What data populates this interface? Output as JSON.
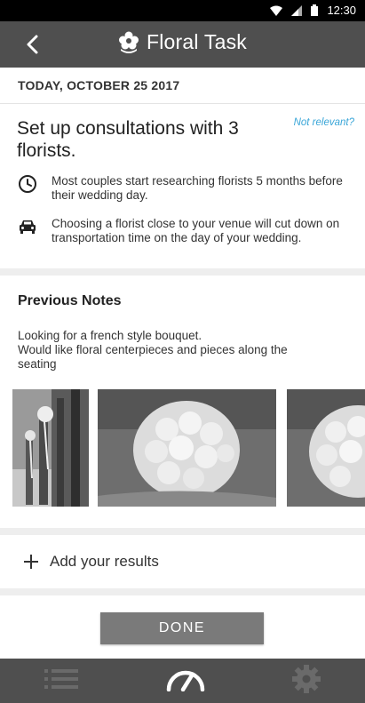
{
  "status_bar": {
    "time": "12:30"
  },
  "app_bar": {
    "title": "Floral Task",
    "back_icon": "arrow-back-icon",
    "title_icon": "flower-icon"
  },
  "date_label": "TODAY, OCTOBER 25 2017",
  "task": {
    "title": "Set up consultations with 3 florists.",
    "not_relevant": "Not relevant?",
    "tips": [
      {
        "icon": "clock-icon",
        "text": "Most couples start researching florists 5 months before their wedding day."
      },
      {
        "icon": "car-icon",
        "text": "Choosing a florist close to your venue will cut down on transportation time on the day of your wedding."
      }
    ]
  },
  "notes": {
    "heading": "Previous Notes",
    "body_line1": "Looking for a french style bouquet.",
    "body_line2": "Would like floral centerpieces and pieces along the seating",
    "photos": [
      "aisle-chairs-photo",
      "rose-bouquet-photo",
      "rose-bouquet-photo-2"
    ]
  },
  "add_results": {
    "label": "Add your results"
  },
  "done_button": {
    "label": "DONE"
  },
  "bottom_nav": {
    "items": [
      "list-icon",
      "dashboard-gauge-icon",
      "settings-gear-icon"
    ]
  },
  "colors": {
    "app_bar": "#4f4f4f",
    "accent_link": "#3aa6d8",
    "done_button": "#7a7a7a"
  }
}
